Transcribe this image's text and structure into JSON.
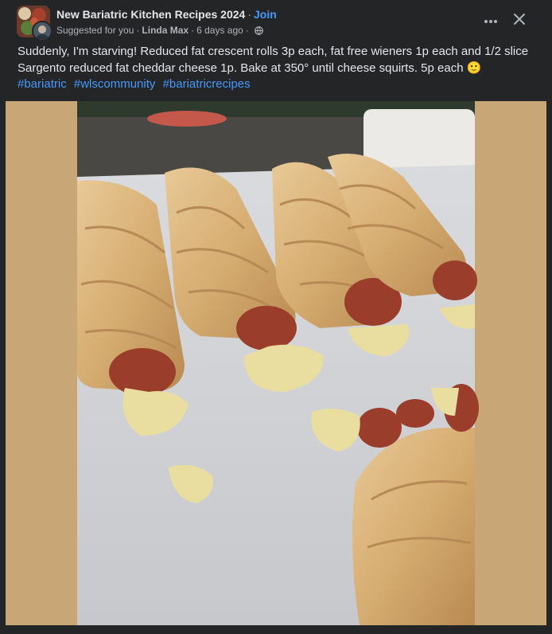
{
  "post": {
    "group_name": "New Bariatric Kitchen Recipes 2024",
    "separator": "·",
    "join_label": "Join",
    "suggested": "Suggested for you",
    "author": "Linda Max",
    "time": "6 days ago",
    "audience_icon": "globe-icon",
    "more_icon": "more-options-icon",
    "close_icon": "close-icon",
    "text_line1": "Suddenly, I'm starving! Reduced fat crescent rolls 3p each, fat free wieners 1p each and 1/2 slice Sargento reduced fat cheddar cheese 1p. Bake at 350° until cheese squirts. 5p each",
    "emoji": "🙂",
    "hashtags": [
      "#bariatric",
      "#wlscommunity",
      "#bariatricrecipes"
    ]
  },
  "colors": {
    "background": "#242526",
    "text": "#e4e6eb",
    "secondary_text": "#b0b3b8",
    "link": "#4599ff",
    "photo_matte": "#c9a676"
  }
}
